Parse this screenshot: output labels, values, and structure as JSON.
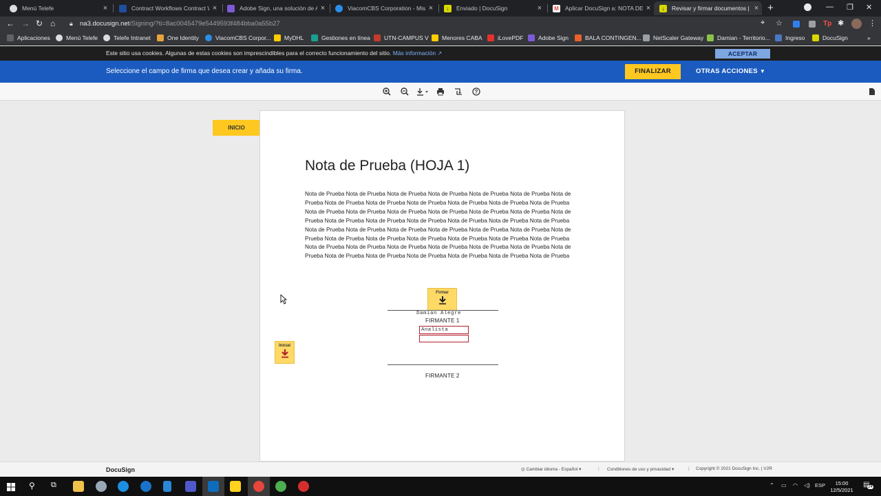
{
  "browser": {
    "tabs": [
      {
        "title": "Menú Telefe",
        "icon": "globe-icon",
        "color": "#dadce0"
      },
      {
        "title": "Contract Workflows Contract Wo",
        "icon": "workflow-icon",
        "color": "#1f4e9e"
      },
      {
        "title": "Adobe Sign, una solución de Ad",
        "icon": "adobe-sign-icon",
        "color": "#7d5bd6"
      },
      {
        "title": "ViacomCBS Corporation - Mis a",
        "icon": "viacom-icon",
        "color": "#2a8ee8"
      },
      {
        "title": "Enviado | DocuSign",
        "icon": "docusign-icon",
        "color": "#d8d800"
      },
      {
        "title": "Aplicar DocuSign a: NOTA DE PR",
        "icon": "gmail-icon",
        "color": "#e04a3a"
      },
      {
        "title": "Revisar y firmar documentos | D",
        "icon": "docusign-icon",
        "color": "#d8d800"
      }
    ],
    "url_host": "na3.docusign.net",
    "url_path": "/Signing/?ti=8ac0045479e5449593f484bba0a55b27",
    "bookmarks": [
      {
        "label": "Aplicaciones",
        "color": "#5f6368"
      },
      {
        "label": "Menú Telefe",
        "color": "#dadce0"
      },
      {
        "label": "Telefe Intranet",
        "color": "#dadce0"
      },
      {
        "label": "One Identity",
        "color": "#e8a33d"
      },
      {
        "label": "ViacomCBS Corpor...",
        "color": "#2a8ee8"
      },
      {
        "label": "MyDHL",
        "color": "#ffcc00"
      },
      {
        "label": "Gestiones en línea",
        "color": "#1a9e8f"
      },
      {
        "label": "UTN-CAMPUS V",
        "color": "#c33b2b"
      },
      {
        "label": "Menores CABA",
        "color": "#ffcc00"
      },
      {
        "label": "iLovePDF",
        "color": "#e5322d"
      },
      {
        "label": "Adobe Sign",
        "color": "#7d5bd6"
      },
      {
        "label": "BALA CONTINGEN...",
        "color": "#e8612c"
      },
      {
        "label": "NetScaler Gateway",
        "color": "#9aa0a6"
      },
      {
        "label": "Damian - Territorio...",
        "color": "#8bc34a"
      },
      {
        "label": "Ingreso",
        "color": "#4a78c2"
      },
      {
        "label": "DocuSign",
        "color": "#d8d800"
      }
    ]
  },
  "cookie_bar": {
    "text": "Este sitio usa cookies. Algunas de estas cookies son imprescindibles para el correcto funcionamiento del sitio.",
    "link": "Más información",
    "accept": "ACEPTAR"
  },
  "action_bar": {
    "message": "Seleccione el campo de firma que desea crear y añada su firma.",
    "finish": "FINALIZAR",
    "other_actions": "OTRAS ACCIONES"
  },
  "toolbar_icons": [
    "zoom-in-icon",
    "zoom-out-icon",
    "download-icon",
    "print-icon",
    "sign-tools-icon",
    "help-icon"
  ],
  "start_button": "INICIO",
  "document": {
    "title": "Nota de Prueba (HOJA 1)",
    "body": "Nota de Prueba Nota de Prueba Nota de Prueba Nota de Prueba Nota de Prueba Nota de Prueba Nota de Prueba Nota de Prueba Nota de Prueba Nota de Prueba Nota de Prueba Nota de Prueba Nota de Prueba Nota de Prueba Nota de Prueba Nota de Prueba Nota de Prueba Nota de Prueba Nota de Prueba Nota de Prueba Nota de Prueba Nota de Prueba Nota de Prueba Nota de Prueba Nota de Prueba Nota de Prueba Nota de Prueba Nota de Prueba Nota de Prueba Nota de Prueba Nota de Prueba Nota de Prueba Nota de Prueba Nota de Prueba Nota de Prueba Nota de Prueba Nota de Prueba Nota de Prueba Nota de Prueba Nota de Prueba Nota de Prueba Nota de Prueba Nota de Prueba Nota de Prueba Nota de Prueba Nota de Prueba Nota de Prueba Nota de Prueba Nota de Prueba Nota de Prueba Nota de Prueba Nota de Prueba",
    "sign_tag": "Firmar",
    "initial_tag": "Inicial",
    "signer1_name": "Damian Alegre",
    "signer1_label": "FIRMANTE 1",
    "signer1_title": "Analista",
    "signer1_extra": "",
    "signer2_label": "FIRMANTE 2"
  },
  "footer": {
    "brand": "DocuSign",
    "language": "Cambiar idioma - Español",
    "terms": "Conditiones de uso y privacidad",
    "copyright": "Copyright © 2021 DocuSign Inc. | V2R"
  },
  "taskbar": {
    "lang": "ESP",
    "time": "15:00",
    "date": "12/5/2021",
    "notifications": "24"
  }
}
